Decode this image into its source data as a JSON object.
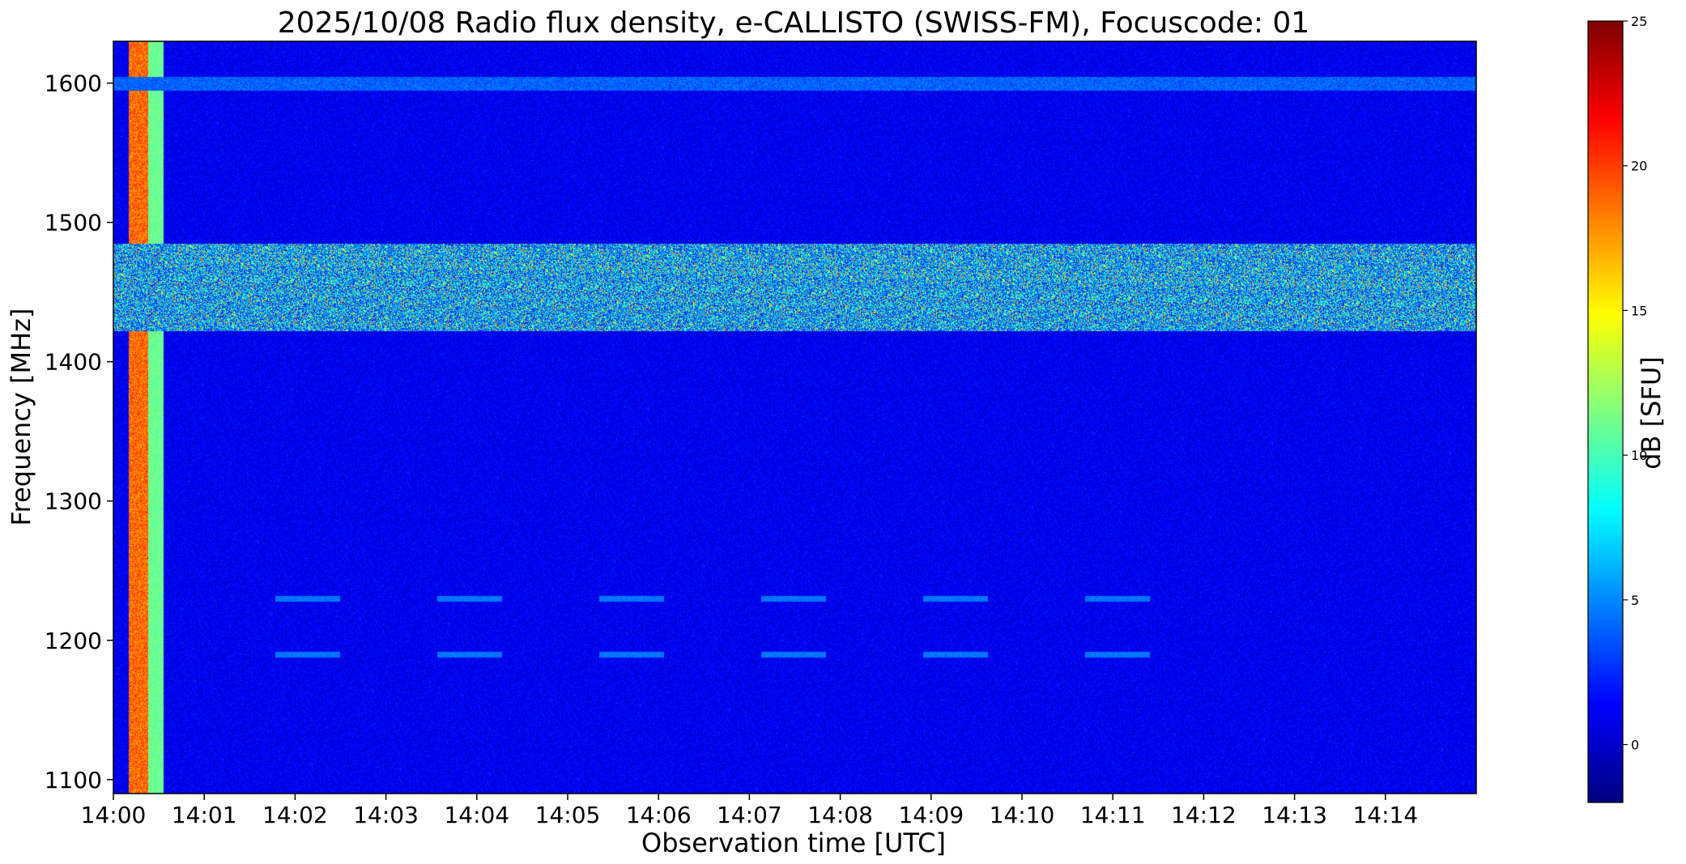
{
  "chart_data": {
    "type": "heatmap",
    "title": "2025/10/08  Radio flux density, e-CALLISTO (SWISS-FM), Focuscode: 01",
    "xlabel": "Observation time [UTC]",
    "ylabel": "Frequency [MHz]",
    "x_range": [
      "14:00:00",
      "14:15:00"
    ],
    "y_range_mhz": [
      1090,
      1630
    ],
    "x_ticks": [
      "14:00",
      "14:01",
      "14:02",
      "14:03",
      "14:04",
      "14:05",
      "14:06",
      "14:07",
      "14:08",
      "14:09",
      "14:10",
      "14:11",
      "14:12",
      "14:13",
      "14:14"
    ],
    "y_ticks": [
      1100,
      1200,
      1300,
      1400,
      1500,
      1600
    ],
    "colormap": "jet",
    "colorbar": {
      "label": "dB [SFU]",
      "range": [
        -2,
        25
      ],
      "ticks": [
        0,
        5,
        10,
        15,
        20,
        25
      ]
    },
    "features": [
      {
        "name": "strong calibration columns",
        "time_range": [
          "14:00:10",
          "14:00:33"
        ],
        "freq_range_mhz": [
          1090,
          1630
        ],
        "level_db": 18
      },
      {
        "name": "broadband interference band",
        "time_range": [
          "14:00:00",
          "14:15:00"
        ],
        "freq_range_mhz": [
          1422,
          1485
        ],
        "level_db": 9
      },
      {
        "name": "narrow band near 1600 MHz",
        "time_range": [
          "14:00:00",
          "14:15:00"
        ],
        "freq_range_mhz": [
          1595,
          1605
        ],
        "level_db": 4
      },
      {
        "name": "intermittent line near 1230 MHz",
        "time_range": [
          "14:01:25",
          "14:12:25"
        ],
        "freq_range_mhz": [
          1228,
          1232
        ],
        "level_db": 4
      },
      {
        "name": "intermittent line near 1190 MHz",
        "time_range": [
          "14:01:25",
          "14:12:25"
        ],
        "freq_range_mhz": [
          1188,
          1192
        ],
        "level_db": 4
      },
      {
        "name": "background",
        "level_db": 1
      }
    ]
  }
}
